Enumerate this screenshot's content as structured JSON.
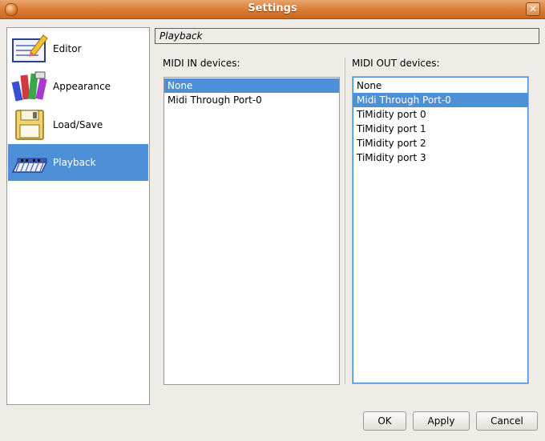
{
  "window": {
    "title": "Settings"
  },
  "sidebar": {
    "items": [
      {
        "label": "Editor",
        "icon": "editor-icon",
        "selected": false
      },
      {
        "label": "Appearance",
        "icon": "appearance-icon",
        "selected": false
      },
      {
        "label": "Load/Save",
        "icon": "floppy-disk-icon",
        "selected": false
      },
      {
        "label": "Playback",
        "icon": "piano-keyboard-icon",
        "selected": true
      }
    ]
  },
  "section": {
    "title": "Playback"
  },
  "midi_in": {
    "label": "MIDI IN devices:",
    "items": [
      "None",
      "Midi Through Port-0"
    ],
    "selected_index": 0
  },
  "midi_out": {
    "label": "MIDI OUT devices:",
    "items": [
      "None",
      "Midi Through Port-0",
      "TiMidity port 0",
      "TiMidity port 1",
      "TiMidity port 2",
      "TiMidity port 3"
    ],
    "selected_index": 1
  },
  "buttons": {
    "ok": "OK",
    "apply": "Apply",
    "cancel": "Cancel"
  },
  "colors": {
    "selection": "#4e90d8",
    "titlebar": "#d97a33"
  }
}
